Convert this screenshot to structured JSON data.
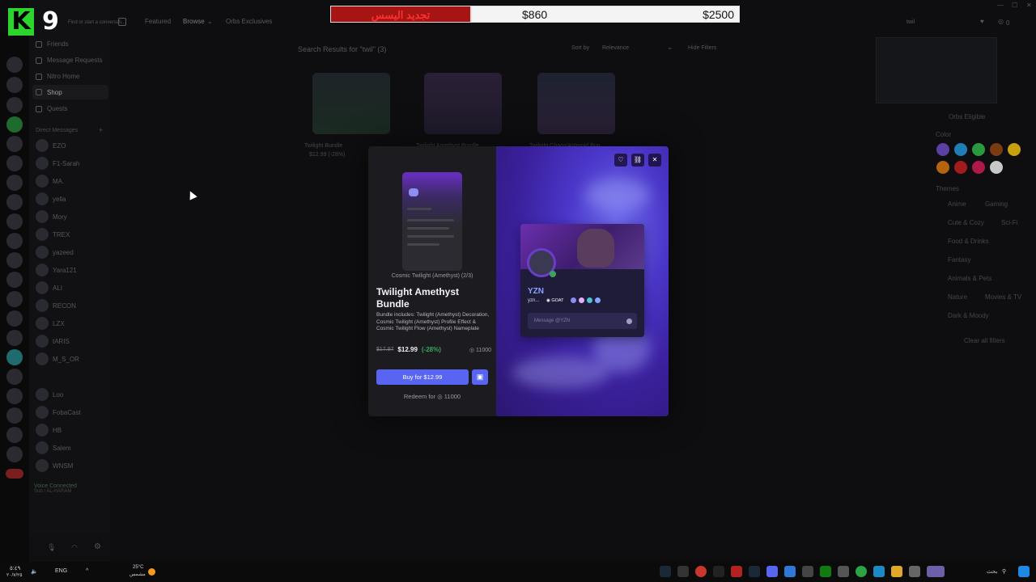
{
  "overlay": {
    "logo_letter": "K",
    "logo_number": "9",
    "price_bar": {
      "label_ar": "تجديد اليسس",
      "current": "$860",
      "goal": "$2500"
    }
  },
  "sidebar": {
    "search_placeholder": "Find or start a conversati...",
    "nav": [
      "Friends",
      "Message Requests",
      "Nitro Home",
      "Shop",
      "Quests"
    ],
    "dm_header": "Direct Messages",
    "dms": [
      "EZO",
      "F1-Sarah",
      "MA.",
      "yella",
      "Mory",
      "TREX",
      "yazeed",
      "Yara121",
      "ALI",
      "RECON",
      "LZX",
      "tARIS",
      "M_S_OR",
      "",
      "Loo",
      "FobaCast",
      "HB",
      "Salem",
      "WNSM"
    ],
    "voice_status": "Voice Connected",
    "voice_channel": "Sub / AL-HARAM"
  },
  "topbar": {
    "nav": [
      "Featured",
      "Browse",
      "Orbs Exclusives"
    ],
    "search": "twil",
    "orbs_count": "0"
  },
  "shop": {
    "results_heading": "Search Results for \"twil\" (3)",
    "sort_label": "Sort by",
    "sort_value": "Relevance",
    "hide_filters": "Hide Filters",
    "cards": [
      {
        "name": "Twilight Bundle",
        "price": "$12.99 (-28%)"
      },
      {
        "name": "Twilight Amethyst Bundle",
        "price": ""
      },
      {
        "name": "Twilight Chaos/Asteroid Bun...",
        "price": ""
      }
    ]
  },
  "filters": {
    "orbs_eligible": "Orbs Eligible",
    "color_label": "Color",
    "colors": [
      "#5b3fa3",
      "#1f7fb5",
      "#2a9a3c",
      "#7a3b12",
      "#c9a10c",
      "#b3640c",
      "#a31c1c",
      "#b0184a",
      "#c8c8c8"
    ],
    "themes_label": "Themes",
    "themes": [
      "Anime",
      "Gaming",
      "Cute & Cozy",
      "Sci-Fi",
      "Food & Drinks",
      "Fantasy",
      "Animals & Pets",
      "Nature",
      "Movies & TV",
      "Dark & Moody"
    ],
    "clear_all": "Clear all filters"
  },
  "modal": {
    "preview_caption": "Cosmic Twilight (Amethyst) (2/3)",
    "title": "Twilight Amethyst Bundle",
    "description": "Bundle includes: Twilight (Amethyst) Decoration, Cosmic Twilight (Amethyst) Profile Effect & Cosmic Twilight Flow (Amethyst) Nameplate",
    "old_price": "$17.97",
    "new_price": "$12.99",
    "discount": "(-28%)",
    "orbs_price": "11000",
    "buy_label": "Buy for $12.99",
    "redeem_label": "Redeem for",
    "redeem_orbs": "11000",
    "profile": {
      "display_name": "YZN",
      "username": "yzn...",
      "tag": "GOAT",
      "message_placeholder": "Message @YZN"
    }
  },
  "taskbar": {
    "time": "٥:٤٩",
    "date": "٢٠/٧/٢٥",
    "lang": "ENG",
    "weather_temp": "25°C",
    "weather_desc": "مشمس",
    "search_label": "بحث"
  }
}
